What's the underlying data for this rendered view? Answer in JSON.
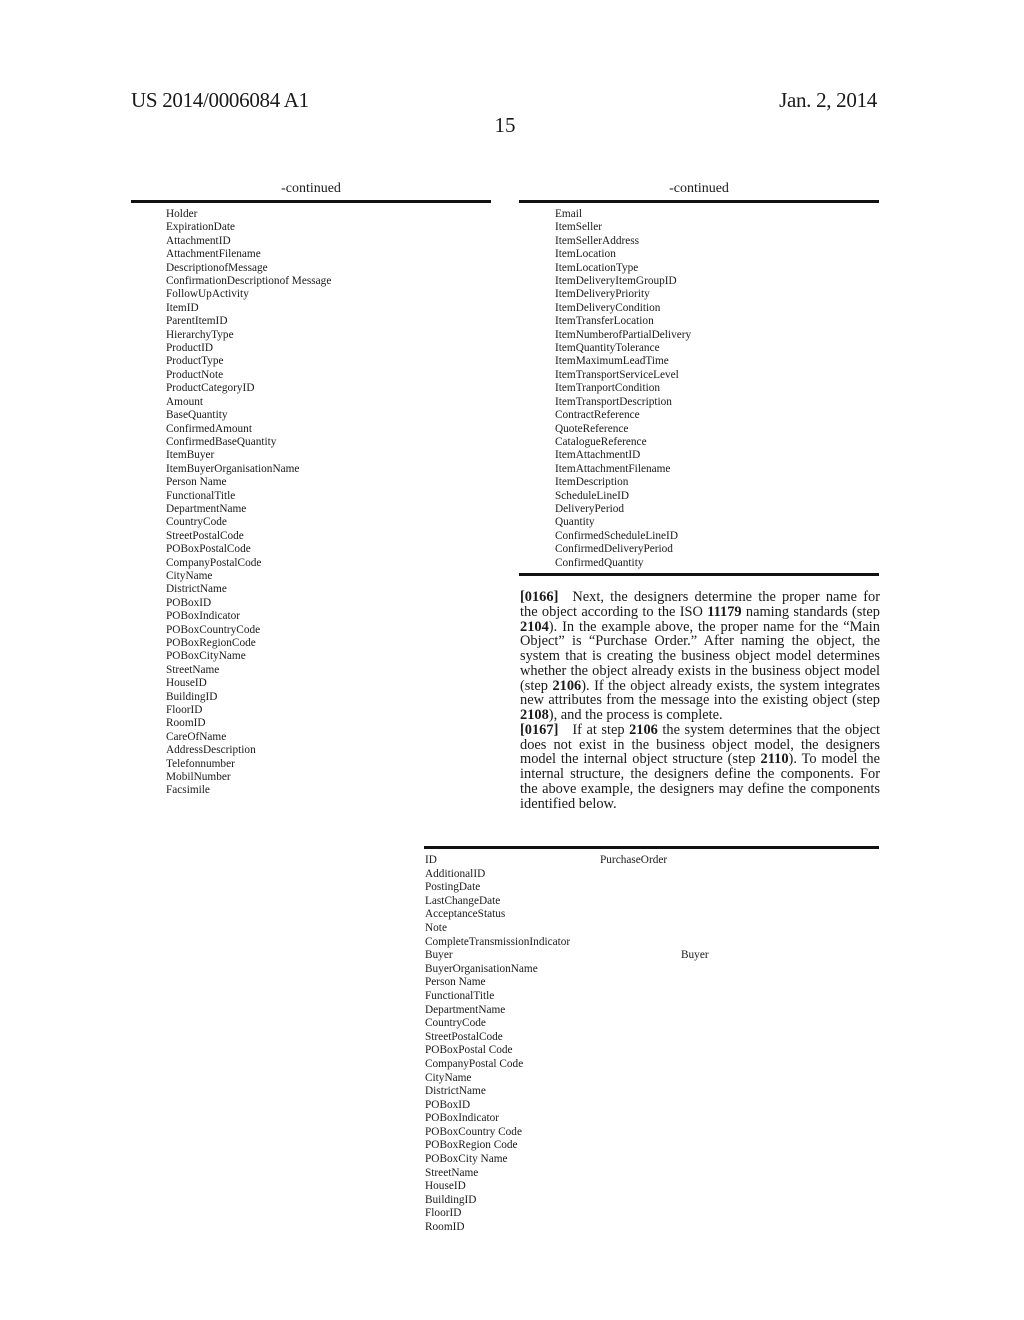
{
  "header": {
    "publication_number": "US 2014/0006084 A1",
    "publication_date": "Jan. 2, 2014",
    "page_number": "15"
  },
  "left_table": {
    "heading": "-continued",
    "items": [
      "Holder",
      "ExpirationDate",
      "AttachmentID",
      "AttachmentFilename",
      "DescriptionofMessage",
      "ConfirmationDescriptionof Message",
      "FollowUpActivity",
      "ItemID",
      "ParentItemID",
      "HierarchyType",
      "ProductID",
      "ProductType",
      "ProductNote",
      "ProductCategoryID",
      "Amount",
      "BaseQuantity",
      "ConfirmedAmount",
      "ConfirmedBaseQuantity",
      "ItemBuyer",
      "ItemBuyerOrganisationName",
      "Person Name",
      "FunctionalTitle",
      "DepartmentName",
      "CountryCode",
      "StreetPostalCode",
      "POBoxPostalCode",
      "CompanyPostalCode",
      "CityName",
      "DistrictName",
      "POBoxID",
      "POBoxIndicator",
      "POBoxCountryCode",
      "POBoxRegionCode",
      "POBoxCityName",
      "StreetName",
      "HouseID",
      "BuildingID",
      "FloorID",
      "RoomID",
      "CareOfName",
      "AddressDescription",
      "Telefonnumber",
      "MobilNumber",
      "Facsimile"
    ]
  },
  "right_table": {
    "heading": "-continued",
    "items": [
      "Email",
      "ItemSeller",
      "ItemSellerAddress",
      "ItemLocation",
      "ItemLocationType",
      "ItemDeliveryItemGroupID",
      "ItemDeliveryPriority",
      "ItemDeliveryCondition",
      "ItemTransferLocation",
      "ItemNumberofPartialDelivery",
      "ItemQuantityTolerance",
      "ItemMaximumLeadTime",
      "ItemTransportServiceLevel",
      "ItemTranportCondition",
      "ItemTransportDescription",
      "ContractReference",
      "QuoteReference",
      "CatalogueReference",
      "ItemAttachmentID",
      "ItemAttachmentFilename",
      "ItemDescription",
      "ScheduleLineID",
      "DeliveryPeriod",
      "Quantity",
      "ConfirmedScheduleLineID",
      "ConfirmedDeliveryPeriod",
      "ConfirmedQuantity"
    ]
  },
  "paragraphs": [
    {
      "number": "[0166]",
      "segments": [
        {
          "text": "Next, the designers determine the proper name for the object according to the ISO ",
          "bold": false
        },
        {
          "text": "11179",
          "bold": true
        },
        {
          "text": " naming standards (step ",
          "bold": false
        },
        {
          "text": "2104",
          "bold": true
        },
        {
          "text": "). In the example above, the proper name for the “Main Object” is “Purchase Order.” After naming the object, the system that is creating the business object model determines whether the object already exists in the business object model (step ",
          "bold": false
        },
        {
          "text": "2106",
          "bold": true
        },
        {
          "text": "). If the object already exists, the system integrates new attributes from the message into the existing object (step ",
          "bold": false
        },
        {
          "text": "2108",
          "bold": true
        },
        {
          "text": "), and the process is complete.",
          "bold": false
        }
      ]
    },
    {
      "number": "[0167]",
      "segments": [
        {
          "text": "If at step ",
          "bold": false
        },
        {
          "text": "2106",
          "bold": true
        },
        {
          "text": " the system determines that the object does not exist in the business object model, the designers model the internal object structure (step ",
          "bold": false
        },
        {
          "text": "2110",
          "bold": true
        },
        {
          "text": "). To model the internal structure, the designers define the components. For the above example, the designers may define the components identified below.",
          "bold": false
        }
      ]
    }
  ],
  "components_table": {
    "rows": [
      {
        "name": "ID",
        "object": "PurchaseOrder",
        "sub": ""
      },
      {
        "name": "AdditionalID",
        "object": "",
        "sub": ""
      },
      {
        "name": "PostingDate",
        "object": "",
        "sub": ""
      },
      {
        "name": "LastChangeDate",
        "object": "",
        "sub": ""
      },
      {
        "name": "AcceptanceStatus",
        "object": "",
        "sub": ""
      },
      {
        "name": "Note",
        "object": "",
        "sub": ""
      },
      {
        "name": "CompleteTransmissionIndicator",
        "object": "",
        "sub": ""
      },
      {
        "name": "Buyer",
        "object": "",
        "sub": "Buyer"
      },
      {
        "name": "BuyerOrganisationName",
        "object": "",
        "sub": ""
      },
      {
        "name": "Person Name",
        "object": "",
        "sub": ""
      },
      {
        "name": "FunctionalTitle",
        "object": "",
        "sub": ""
      },
      {
        "name": "DepartmentName",
        "object": "",
        "sub": ""
      },
      {
        "name": "CountryCode",
        "object": "",
        "sub": ""
      },
      {
        "name": "StreetPostalCode",
        "object": "",
        "sub": ""
      },
      {
        "name": "POBoxPostal Code",
        "object": "",
        "sub": ""
      },
      {
        "name": "CompanyPostal Code",
        "object": "",
        "sub": ""
      },
      {
        "name": "CityName",
        "object": "",
        "sub": ""
      },
      {
        "name": "DistrictName",
        "object": "",
        "sub": ""
      },
      {
        "name": "POBoxID",
        "object": "",
        "sub": ""
      },
      {
        "name": "POBoxIndicator",
        "object": "",
        "sub": ""
      },
      {
        "name": "POBoxCountry Code",
        "object": "",
        "sub": ""
      },
      {
        "name": "POBoxRegion Code",
        "object": "",
        "sub": ""
      },
      {
        "name": "POBoxCity Name",
        "object": "",
        "sub": ""
      },
      {
        "name": "StreetName",
        "object": "",
        "sub": ""
      },
      {
        "name": "HouseID",
        "object": "",
        "sub": ""
      },
      {
        "name": "BuildingID",
        "object": "",
        "sub": ""
      },
      {
        "name": "FloorID",
        "object": "",
        "sub": ""
      },
      {
        "name": "RoomID",
        "object": "",
        "sub": ""
      }
    ]
  }
}
